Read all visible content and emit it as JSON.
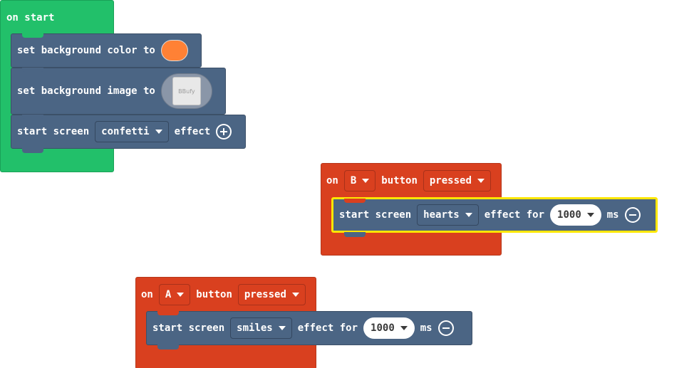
{
  "on_start": {
    "label": "on start",
    "set_bg_color": {
      "label": "set background color to",
      "color": "#ff8135"
    },
    "set_bg_image": {
      "label": "set background image to",
      "thumb_text": "BBufy"
    },
    "start_screen": {
      "label_start": "start screen",
      "effect": "confetti",
      "label_effect": "effect"
    }
  },
  "on_b": {
    "label_on": "on",
    "button": "B",
    "label_button": "button",
    "event": "pressed",
    "start_screen": {
      "label_start": "start screen",
      "effect": "hearts",
      "label_effect_for": "effect for",
      "duration": "1000",
      "label_ms": "ms"
    }
  },
  "on_a": {
    "label_on": "on",
    "button": "A",
    "label_button": "button",
    "event": "pressed",
    "start_screen": {
      "label_start": "start screen",
      "effect": "smiles",
      "label_effect_for": "effect for",
      "duration": "1000",
      "label_ms": "ms"
    }
  },
  "icons": {
    "add": "plus-circle-icon",
    "remove": "minus-circle-icon",
    "dropdown": "caret-down-icon"
  },
  "colors": {
    "event_green": "#22c06a",
    "event_red": "#d9401f",
    "statement_blue": "#4b6584",
    "selection_yellow": "#ffe700"
  }
}
